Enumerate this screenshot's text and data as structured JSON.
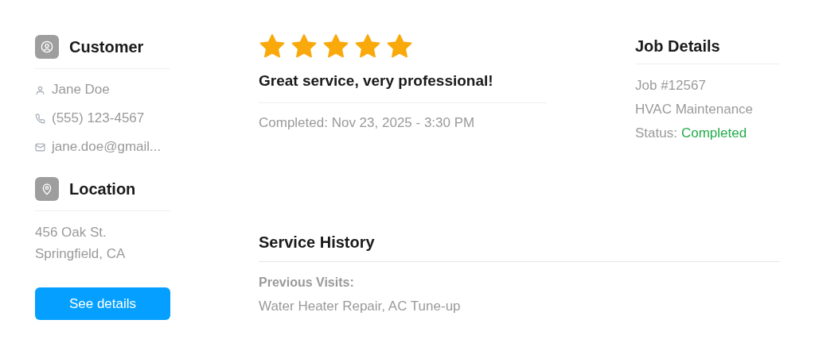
{
  "customer": {
    "title": "Customer",
    "contacts": [
      {
        "kind": "person",
        "text": "Jane Doe"
      },
      {
        "kind": "phone",
        "text": "(555) 123-4567"
      },
      {
        "kind": "email",
        "text": "jane.doe@gmail..."
      }
    ]
  },
  "location": {
    "title": "Location",
    "lines": [
      "456 Oak St.",
      "Springfield, CA"
    ]
  },
  "details_button": "See details",
  "review": {
    "stars": 5,
    "comment": "Great service, very professional!",
    "completed": "Completed: Nov 23, 2025 - 3:30 PM"
  },
  "job_details": {
    "title": "Job Details",
    "job_number": "Job #12567",
    "service": "HVAC Maintenance",
    "status_label": "Status:",
    "status_value": "Completed"
  },
  "service_history": {
    "title": "Service History",
    "label": "Previous Visits:",
    "visits": "Water Heater Repair, AC Tune-up"
  }
}
